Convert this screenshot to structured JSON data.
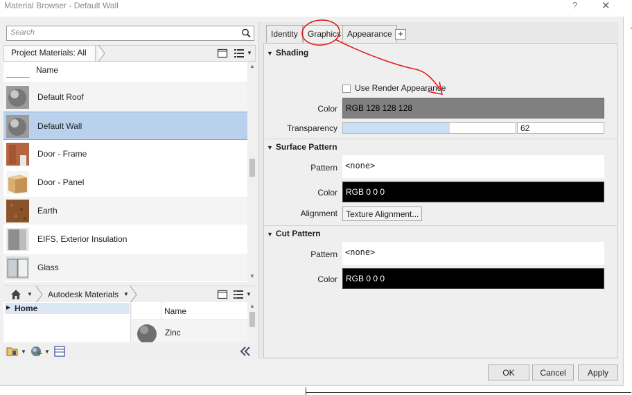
{
  "window": {
    "title": "Material Browser - Default Wall",
    "help_glyph": "?",
    "close_glyph": "✕"
  },
  "search": {
    "placeholder": "Search"
  },
  "project": {
    "breadcrumb": "Project Materials: All"
  },
  "materials_list": {
    "header": "Name",
    "items": [
      {
        "name": "Default Roof",
        "thumb": "gray-sphere"
      },
      {
        "name": "Default Wall",
        "thumb": "gray-sphere",
        "selected": true
      },
      {
        "name": "Door - Frame",
        "thumb": "wood-frame"
      },
      {
        "name": "Door - Panel",
        "thumb": "wood-cube"
      },
      {
        "name": "Earth",
        "thumb": "earth"
      },
      {
        "name": "EIFS, Exterior Insulation",
        "thumb": "eifs"
      },
      {
        "name": "Glass",
        "thumb": "glass"
      }
    ]
  },
  "library": {
    "breadcrumb": "Autodesk Materials",
    "tree_home": "Home",
    "grid_header": "Name",
    "grid_items": [
      {
        "name": "Zinc"
      }
    ]
  },
  "tabs": [
    "Identity",
    "Graphics",
    "Appearance"
  ],
  "active_tab": "Graphics",
  "shading": {
    "header": "Shading",
    "use_render_label": "Use Render Appearance",
    "color_label": "Color",
    "color_value": "RGB 128 128 128",
    "transparency_label": "Transparency",
    "transparency_value": "62",
    "transparency_fraction": 0.62
  },
  "surface_pattern": {
    "header": "Surface Pattern",
    "pattern_label": "Pattern",
    "pattern_value": "<none>",
    "color_label": "Color",
    "color_value": "RGB 0 0 0",
    "alignment_label": "Alignment",
    "alignment_button": "Texture Alignment..."
  },
  "cut_pattern": {
    "header": "Cut Pattern",
    "pattern_label": "Pattern",
    "pattern_value": "<none>",
    "color_label": "Color",
    "color_value": "RGB 0 0 0"
  },
  "footer": {
    "ok": "OK",
    "cancel": "Cancel",
    "apply": "Apply"
  },
  "icons": [
    "search-icon",
    "panel-view-icon",
    "list-view-icon",
    "home-icon",
    "folder-icon",
    "add-material-icon",
    "editor-toggle-icon",
    "collapse-double-left-icon"
  ],
  "colors": {
    "selection": "#b9d1ec",
    "annotation": "#e21b1b",
    "shading_swatch": "#808080"
  }
}
